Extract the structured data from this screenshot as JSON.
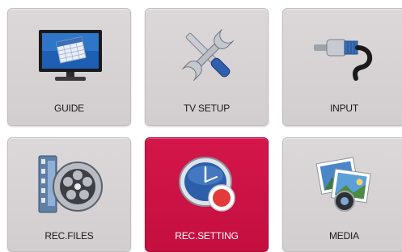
{
  "menu": {
    "items": [
      {
        "id": "guide",
        "label": "GUIDE",
        "icon": "guide-monitor-icon",
        "selected": false
      },
      {
        "id": "tv-setup",
        "label": "TV SETUP",
        "icon": "tools-wrench-screwdriver-icon",
        "selected": false
      },
      {
        "id": "input",
        "label": "INPUT",
        "icon": "cable-plug-icon",
        "selected": false
      },
      {
        "id": "rec-files",
        "label": "REC.FILES",
        "icon": "film-reel-icon",
        "selected": false
      },
      {
        "id": "rec-setting",
        "label": "REC.SETTING",
        "icon": "record-clock-icon",
        "selected": true
      },
      {
        "id": "media",
        "label": "MEDIA",
        "icon": "photos-media-icon",
        "selected": false
      }
    ]
  },
  "colors": {
    "tile": "#d6d2d3",
    "selected_tile": "#c8124a",
    "label": "#1b1b1b",
    "selected_label": "#ffffff"
  }
}
